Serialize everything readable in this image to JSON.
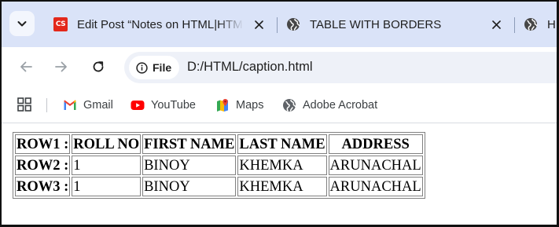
{
  "tabs": [
    {
      "title": "Edit Post “Notes on HTML|HTM",
      "icon": "codespeedy-favicon-icon",
      "icon_text": "CS",
      "active": false
    },
    {
      "title": "TABLE WITH BORDERS",
      "icon": "globe-icon",
      "active": true
    },
    {
      "title": "H",
      "icon": "globe-icon",
      "active": false
    }
  ],
  "toolbar": {
    "site_chip_label": "File",
    "url": "D:/HTML/caption.html"
  },
  "bookmarks": [
    {
      "label": "Gmail",
      "icon": "gmail-icon"
    },
    {
      "label": "YouTube",
      "icon": "youtube-icon"
    },
    {
      "label": "Maps",
      "icon": "maps-icon"
    },
    {
      "label": "Adobe Acrobat",
      "icon": "globe-icon"
    }
  ],
  "table": {
    "headers": [
      "ROW1 :",
      "ROLL NO",
      "FIRST NAME",
      "LAST NAME",
      "ADDRESS"
    ],
    "rows": [
      {
        "label": "ROW2 :",
        "cells": [
          "1",
          "BINOY",
          "KHEMKA",
          "ARUNACHAL"
        ]
      },
      {
        "label": "ROW3 :",
        "cells": [
          "1",
          "BINOY",
          "KHEMKA",
          "ARUNACHAL"
        ]
      }
    ]
  },
  "colors": {
    "tabstrip_bg": "#dae3f8",
    "omnibox_bg": "#eef1f8",
    "codespeedy_red": "#e3281b",
    "youtube_red": "#ff0000",
    "table_border": "#808080"
  }
}
